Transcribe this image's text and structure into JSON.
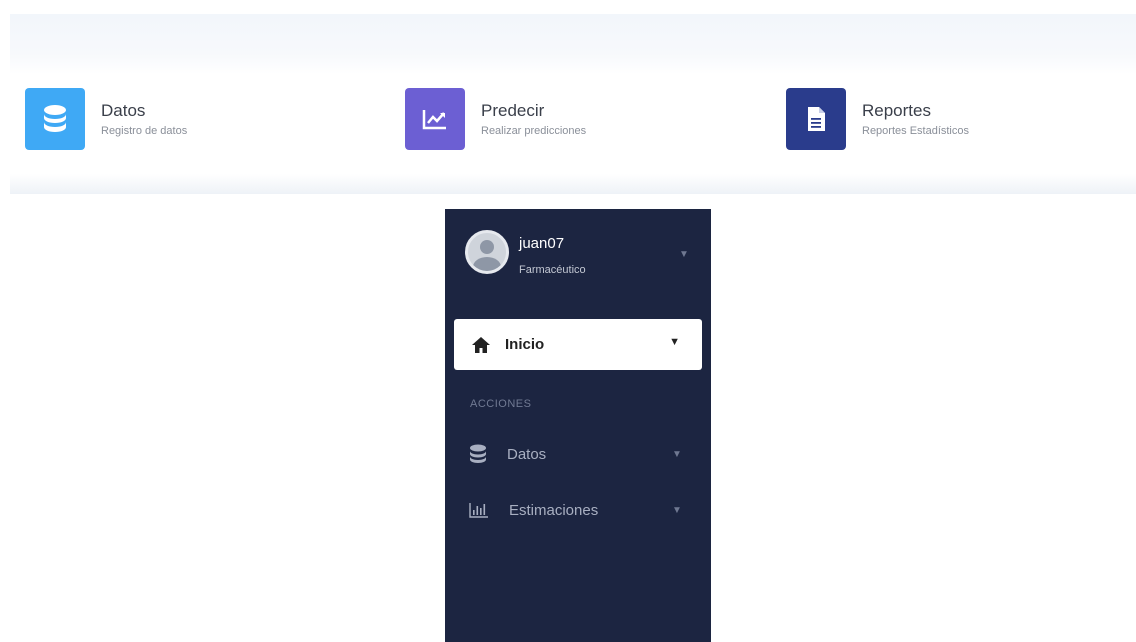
{
  "cards": [
    {
      "title": "Datos",
      "subtitle": "Registro de datos",
      "icon": "database-icon",
      "color": "#3fa9f5"
    },
    {
      "title": "Predecir",
      "subtitle": "Realizar predicciones",
      "icon": "chart-line-icon",
      "color": "#6c5fd3"
    },
    {
      "title": "Reportes",
      "subtitle": "Reportes Estadísticos",
      "icon": "file-icon",
      "color": "#2a3c8c"
    }
  ],
  "sidebar": {
    "background": "#1c2541",
    "user": {
      "name": "juan07",
      "role": "Farmacéutico"
    },
    "active_item": {
      "label": "Inicio",
      "icon": "home-icon"
    },
    "section_title": "ACCIONES",
    "items": [
      {
        "label": "Datos",
        "icon": "database-icon"
      },
      {
        "label": "Estimaciones",
        "icon": "bar-chart-icon"
      }
    ]
  }
}
